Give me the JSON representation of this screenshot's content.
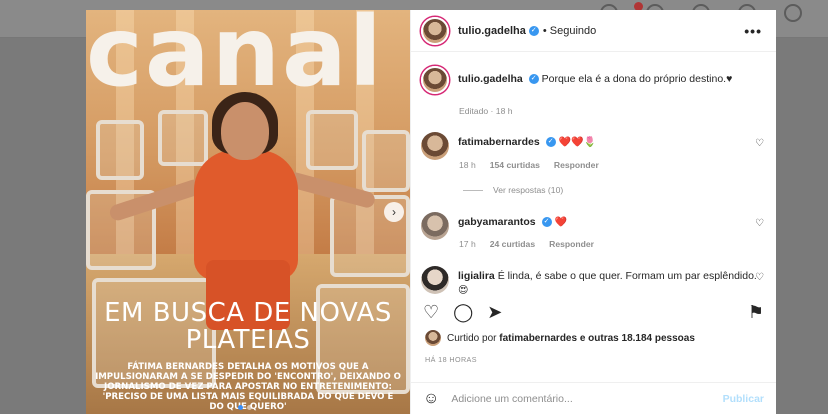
{
  "post": {
    "author": "tulio.gadelha",
    "follow_status": "Seguindo",
    "more_label": "•••",
    "image": {
      "logo_text": "canal",
      "headline": "EM BUSCA DE NOVAS PLATEIAS",
      "subline": "FÁTIMA BERNARDES DETALHA OS MOTIVOS QUE A IMPULSIONARAM A SE DESPEDIR DO 'ENCONTRO', DEIXANDO O JORNALISMO DE VEZ PARA APOSTAR NO ENTRETENIMENTO: 'PRECISO DE UMA LISTA MAIS EQUILIBRADA DO QUE DEVO E DO QUE QUERO'",
      "next_arrow": "›"
    },
    "caption": {
      "user": "tulio.gadelha",
      "text": "Porque ela é a dona do próprio destino.♥",
      "edited": "Editado · 18 h"
    },
    "comments": [
      {
        "user": "fatimabernardes",
        "text": "❤️❤️🌷",
        "time": "18 h",
        "likes": "154 curtidas",
        "reply": "Responder",
        "view_replies": "Ver respostas (10)"
      },
      {
        "user": "gabyamarantos",
        "text": "❤️",
        "time": "17 h",
        "likes": "24 curtidas",
        "reply": "Responder"
      },
      {
        "user": "ligialira",
        "text": "É linda, é sabe o que quer. Formam um par esplêndido.",
        "emoji": "😍"
      }
    ],
    "liked_by": {
      "prefix": "Curtido por",
      "user": "fatimabernardes",
      "suffix": "e outras 18.184 pessoas"
    },
    "timestamp": "HÁ 18 HORAS",
    "comment_box": {
      "placeholder": "Adicione um comentário...",
      "post_label": "Publicar"
    },
    "colors": {
      "verified": "#3897f0",
      "post_button": "#b2dffc",
      "accent_dress": "#e05b2c"
    }
  }
}
